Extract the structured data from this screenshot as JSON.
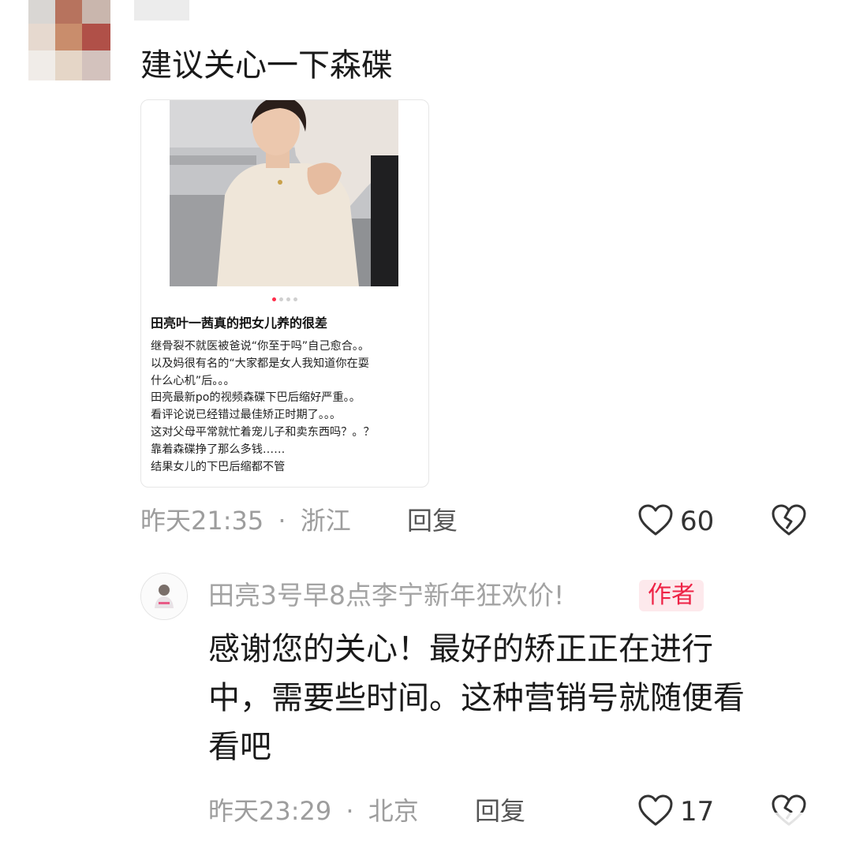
{
  "comment": {
    "text": "建议关心一下森碟",
    "post_card": {
      "title": "田亮叶一茜真的把女儿养的很差",
      "body_lines": [
        "继骨裂不就医被爸说“你至于吗”自己愈合。。",
        "以及妈很有名的“大家都是女人我知道你在耍",
        "什么心机”后。。。",
        "田亮最新po的视频森碟下巴后缩好严重。。",
        "看评论说已经错过最佳矫正时期了。。。",
        "这对父母平常就忙着宠儿子和卖东西吗？。？",
        "靠着森碟挣了那么多钱……",
        "结果女儿的下巴后缩都不管"
      ],
      "carousel_dots": 4,
      "active_dot": 0
    },
    "meta": {
      "time": "昨天21:35",
      "separator": "·",
      "location": "浙江"
    },
    "reply_label": "回复",
    "like_count": "60"
  },
  "author_reply": {
    "username": "田亮3号早8点李宁新年狂欢价!",
    "badge": "作者",
    "text_lines": [
      "感谢您的关心！最好的矫正正在进行",
      "中，需要些时间。这种营销号就随便看",
      "看吧"
    ],
    "meta": {
      "time": "昨天23:29",
      "separator": "·",
      "location": "北京"
    },
    "reply_label": "回复",
    "like_count": "17"
  },
  "colors": {
    "author_badge_bg": "#fde9ec",
    "author_badge_text": "#ee2346",
    "carousel_active": "#ff2d4a"
  },
  "icons": [
    "heart-outline-icon",
    "broken-heart-icon"
  ]
}
